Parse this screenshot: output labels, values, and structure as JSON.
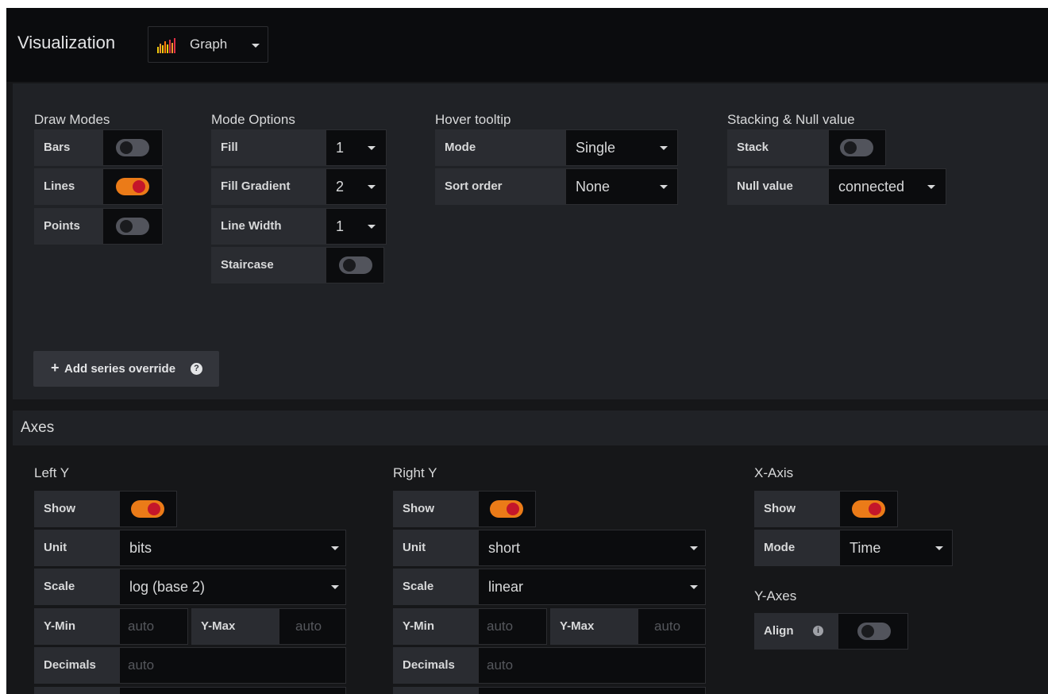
{
  "visualization": {
    "title": "Visualization",
    "picker_label": "Graph",
    "picker_icon": "graph-bars-icon"
  },
  "draw_modes": {
    "heading": "Draw Modes",
    "bars": {
      "label": "Bars",
      "on": false
    },
    "lines": {
      "label": "Lines",
      "on": true
    },
    "points": {
      "label": "Points",
      "on": false
    }
  },
  "mode_options": {
    "heading": "Mode Options",
    "fill": {
      "label": "Fill",
      "value": "1"
    },
    "fill_gradient": {
      "label": "Fill Gradient",
      "value": "2"
    },
    "line_width": {
      "label": "Line Width",
      "value": "1"
    },
    "staircase": {
      "label": "Staircase",
      "on": false
    }
  },
  "hover_tooltip": {
    "heading": "Hover tooltip",
    "mode": {
      "label": "Mode",
      "value": "Single"
    },
    "sort_order": {
      "label": "Sort order",
      "value": "None"
    }
  },
  "stacking": {
    "heading": "Stacking & Null value",
    "stack": {
      "label": "Stack",
      "on": false
    },
    "null_value": {
      "label": "Null value",
      "value": "connected"
    }
  },
  "add_override": {
    "label": "Add series override",
    "plus": "+",
    "help": "?"
  },
  "axes": {
    "title": "Axes",
    "left_y": {
      "heading": "Left Y",
      "show": {
        "label": "Show",
        "on": true
      },
      "unit": {
        "label": "Unit",
        "value": "bits"
      },
      "scale": {
        "label": "Scale",
        "value": "log (base 2)"
      },
      "y_min": {
        "label": "Y-Min",
        "placeholder": "auto"
      },
      "y_max": {
        "label": "Y-Max",
        "placeholder": "auto"
      },
      "decimals": {
        "label": "Decimals",
        "placeholder": "auto"
      }
    },
    "right_y": {
      "heading": "Right Y",
      "show": {
        "label": "Show",
        "on": true
      },
      "unit": {
        "label": "Unit",
        "value": "short"
      },
      "scale": {
        "label": "Scale",
        "value": "linear"
      },
      "y_min": {
        "label": "Y-Min",
        "placeholder": "auto"
      },
      "y_max": {
        "label": "Y-Max",
        "placeholder": "auto"
      },
      "decimals": {
        "label": "Decimals",
        "placeholder": "auto"
      }
    },
    "x_axis": {
      "heading": "X-Axis",
      "show": {
        "label": "Show",
        "on": true
      },
      "mode": {
        "label": "Mode",
        "value": "Time"
      }
    },
    "y_axes": {
      "heading": "Y-Axes",
      "align": {
        "label": "Align",
        "on": false,
        "info": "i"
      }
    }
  },
  "colors": {
    "toggle_on": "#eb7b18",
    "toggle_knob_on": "#c4162a",
    "toggle_off": "#52545c",
    "panel_bg": "#202226",
    "input_bg": "#0b0c0e",
    "label_bg": "#2a2c31"
  }
}
